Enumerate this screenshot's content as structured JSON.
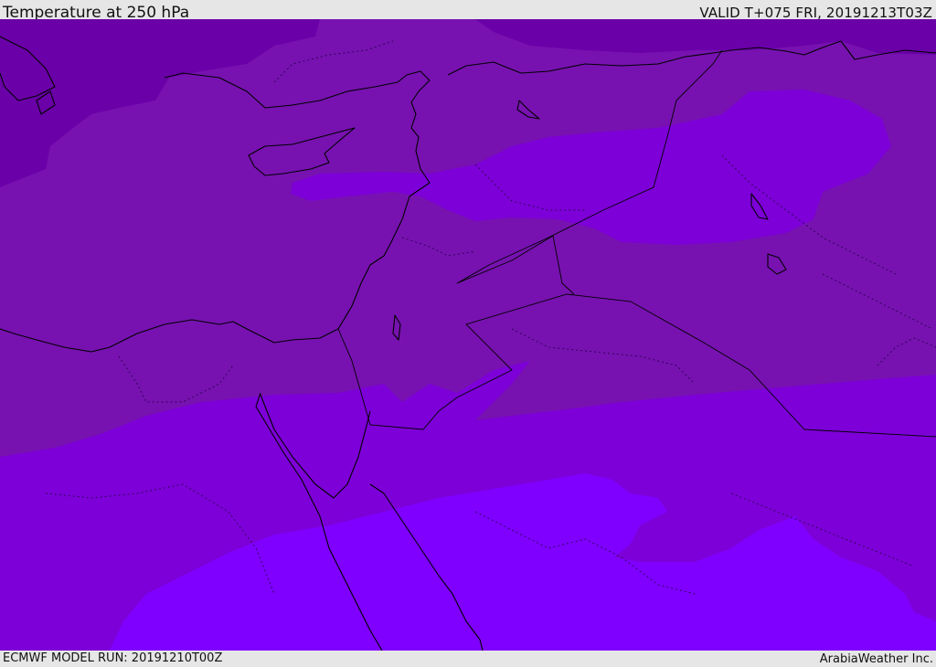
{
  "header": {
    "title": "Temperature at 250 hPa",
    "valid_time": "VALID T+075 FRI, 20191213T03Z"
  },
  "footer": {
    "model_run": "ECMWF MODEL RUN: 20191210T00Z",
    "credit": "ArabiaWeather Inc."
  },
  "colors": {
    "band_coldest": "#6a00a8",
    "band_cold": "#7712b0",
    "band_mid": "#7d00d8",
    "band_warm": "#7f00ff",
    "coastline": "#000000",
    "borders": "#2a0050"
  }
}
